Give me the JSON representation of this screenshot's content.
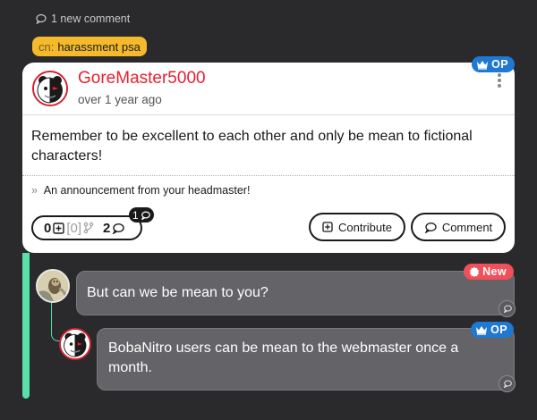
{
  "thread": {
    "new_comments_label": "1 new comment",
    "content_notice": {
      "prefix": "cn:",
      "label": "harassment psa"
    }
  },
  "post": {
    "author": "GoreMaster5000",
    "time_ago": "over 1 year ago",
    "body": "Remember to be excellent to each other and only be mean to fictional characters!",
    "whisper": "An announcement from your headmaster!",
    "op_badge": "OP",
    "stats": {
      "contributions": "0",
      "threads_open": "[0]",
      "comments": "2",
      "new_comments": "1"
    },
    "actions": {
      "contribute_label": "Contribute",
      "comment_label": "Comment"
    }
  },
  "comments": [
    {
      "text": "But can we be mean to you?",
      "badge": "New",
      "badge_color": "#f0505a"
    },
    {
      "text": "BobaNitro users can be mean to the webmaster once a month.",
      "badge": "OP",
      "badge_color": "#1f78d1"
    }
  ],
  "colors": {
    "background": "#2a2a2d",
    "author": "#e8202f",
    "content_notice": "#f5ba2c",
    "thread_accent": "#58e0a8",
    "comment_bubble": "#646468"
  }
}
